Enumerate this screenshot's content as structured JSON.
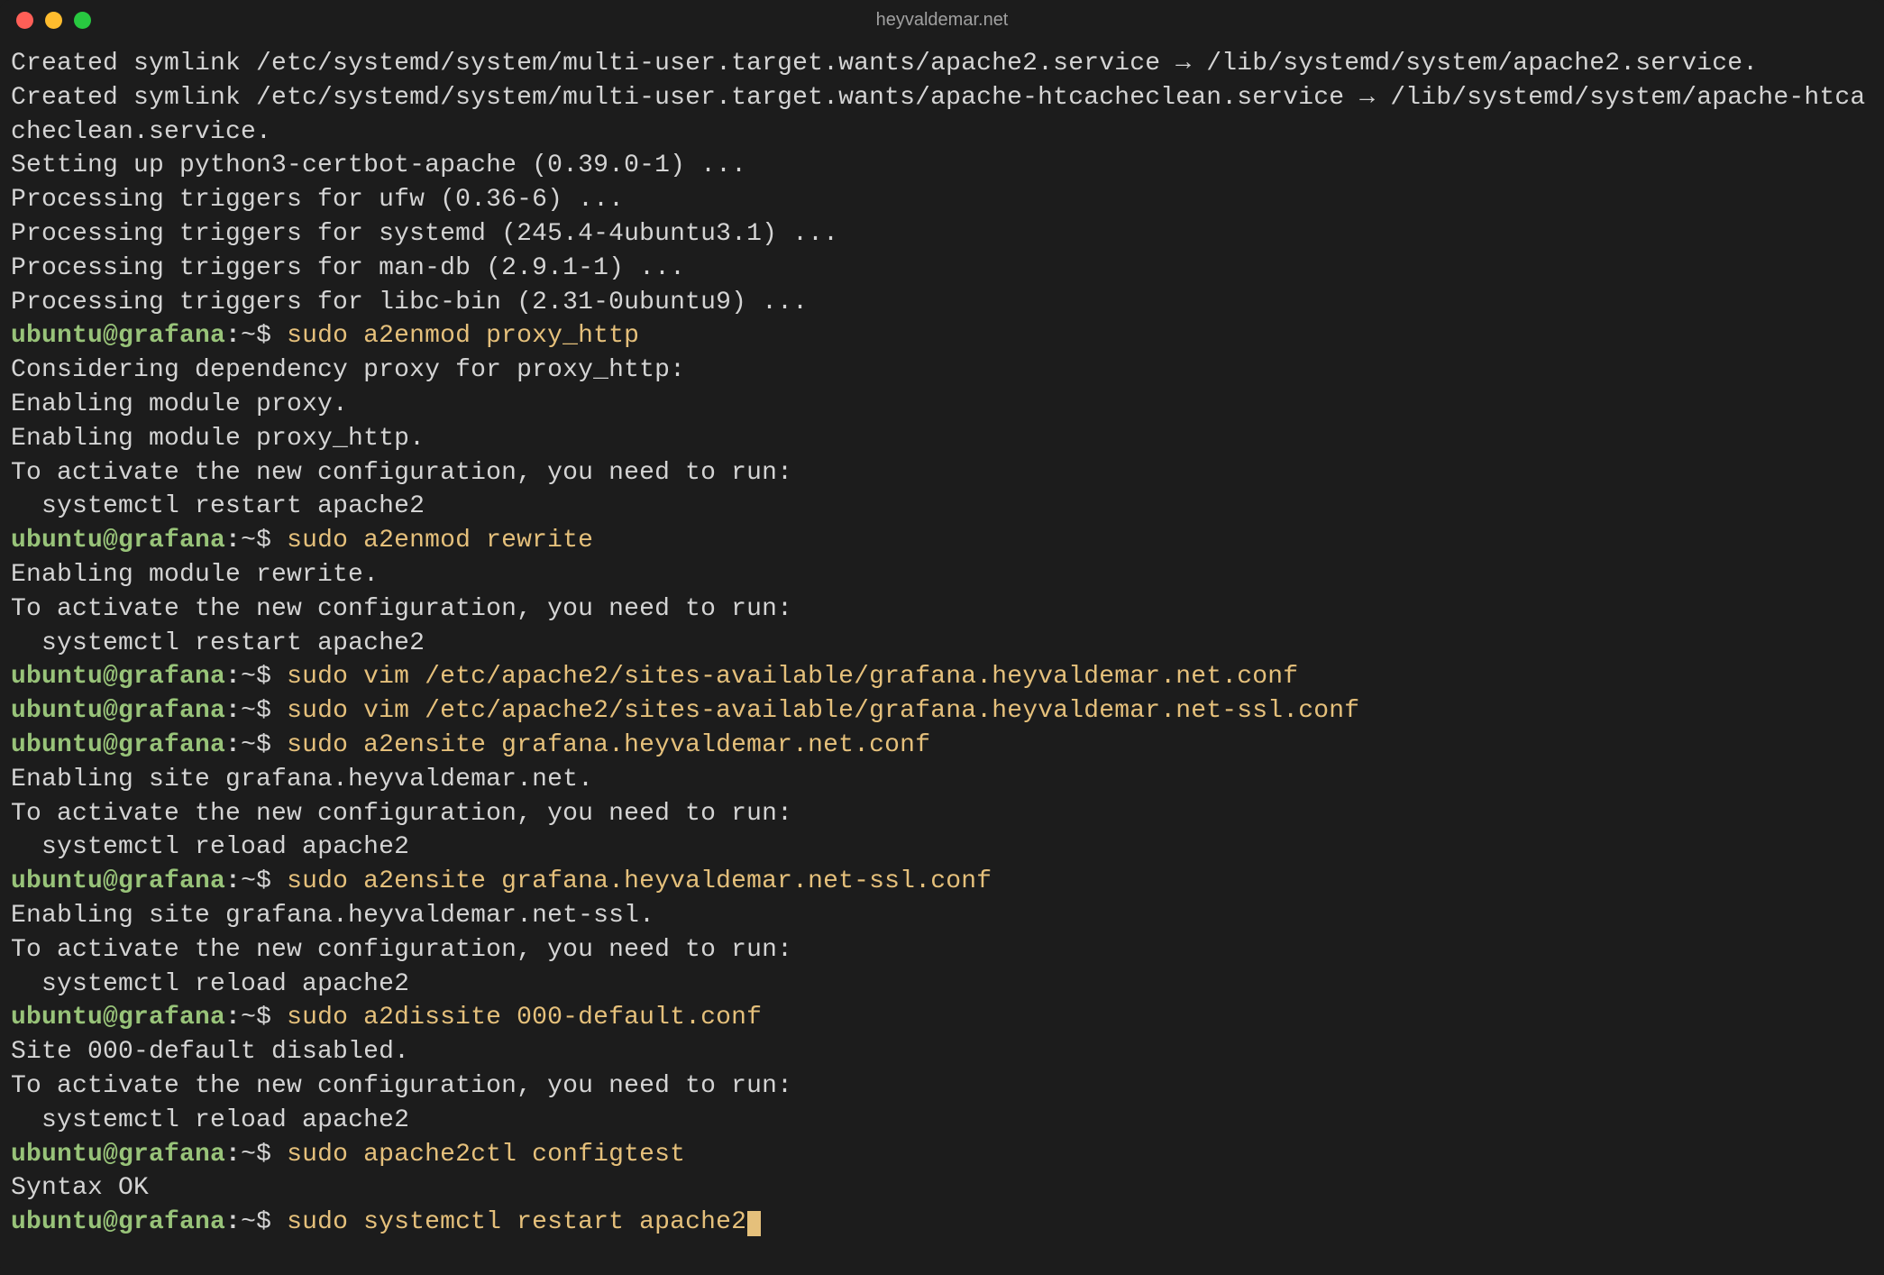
{
  "window": {
    "title": "heyvaldemar.net"
  },
  "prompt": {
    "user_host": "ubuntu@grafana",
    "separator": ":",
    "path_marker": "~$ "
  },
  "lines": [
    {
      "type": "output",
      "text": "Created symlink /etc/systemd/system/multi-user.target.wants/apache2.service → /lib/systemd/system/apache2.service."
    },
    {
      "type": "output",
      "text": "Created symlink /etc/systemd/system/multi-user.target.wants/apache-htcacheclean.service → /lib/systemd/system/apache-htcacheclean.service."
    },
    {
      "type": "output",
      "text": "Setting up python3-certbot-apache (0.39.0-1) ..."
    },
    {
      "type": "output",
      "text": "Processing triggers for ufw (0.36-6) ..."
    },
    {
      "type": "output",
      "text": "Processing triggers for systemd (245.4-4ubuntu3.1) ..."
    },
    {
      "type": "output",
      "text": "Processing triggers for man-db (2.9.1-1) ..."
    },
    {
      "type": "output",
      "text": "Processing triggers for libc-bin (2.31-0ubuntu9) ..."
    },
    {
      "type": "prompt",
      "cmd": "sudo a2enmod proxy_http"
    },
    {
      "type": "output",
      "text": "Considering dependency proxy for proxy_http:"
    },
    {
      "type": "output",
      "text": "Enabling module proxy."
    },
    {
      "type": "output",
      "text": "Enabling module proxy_http."
    },
    {
      "type": "output",
      "text": "To activate the new configuration, you need to run:"
    },
    {
      "type": "output",
      "text": "  systemctl restart apache2"
    },
    {
      "type": "prompt",
      "cmd": "sudo a2enmod rewrite"
    },
    {
      "type": "output",
      "text": "Enabling module rewrite."
    },
    {
      "type": "output",
      "text": "To activate the new configuration, you need to run:"
    },
    {
      "type": "output",
      "text": "  systemctl restart apache2"
    },
    {
      "type": "prompt",
      "cmd": "sudo vim /etc/apache2/sites-available/grafana.heyvaldemar.net.conf"
    },
    {
      "type": "prompt",
      "cmd": "sudo vim /etc/apache2/sites-available/grafana.heyvaldemar.net-ssl.conf"
    },
    {
      "type": "prompt",
      "cmd": "sudo a2ensite grafana.heyvaldemar.net.conf"
    },
    {
      "type": "output",
      "text": "Enabling site grafana.heyvaldemar.net."
    },
    {
      "type": "output",
      "text": "To activate the new configuration, you need to run:"
    },
    {
      "type": "output",
      "text": "  systemctl reload apache2"
    },
    {
      "type": "prompt",
      "cmd": "sudo a2ensite grafana.heyvaldemar.net-ssl.conf"
    },
    {
      "type": "output",
      "text": "Enabling site grafana.heyvaldemar.net-ssl."
    },
    {
      "type": "output",
      "text": "To activate the new configuration, you need to run:"
    },
    {
      "type": "output",
      "text": "  systemctl reload apache2"
    },
    {
      "type": "prompt",
      "cmd": "sudo a2dissite 000-default.conf"
    },
    {
      "type": "output",
      "text": "Site 000-default disabled."
    },
    {
      "type": "output",
      "text": "To activate the new configuration, you need to run:"
    },
    {
      "type": "output",
      "text": "  systemctl reload apache2"
    },
    {
      "type": "prompt",
      "cmd": "sudo apache2ctl configtest"
    },
    {
      "type": "output",
      "text": "Syntax OK"
    },
    {
      "type": "prompt",
      "cmd": "sudo systemctl restart apache2",
      "cursor": true
    }
  ]
}
